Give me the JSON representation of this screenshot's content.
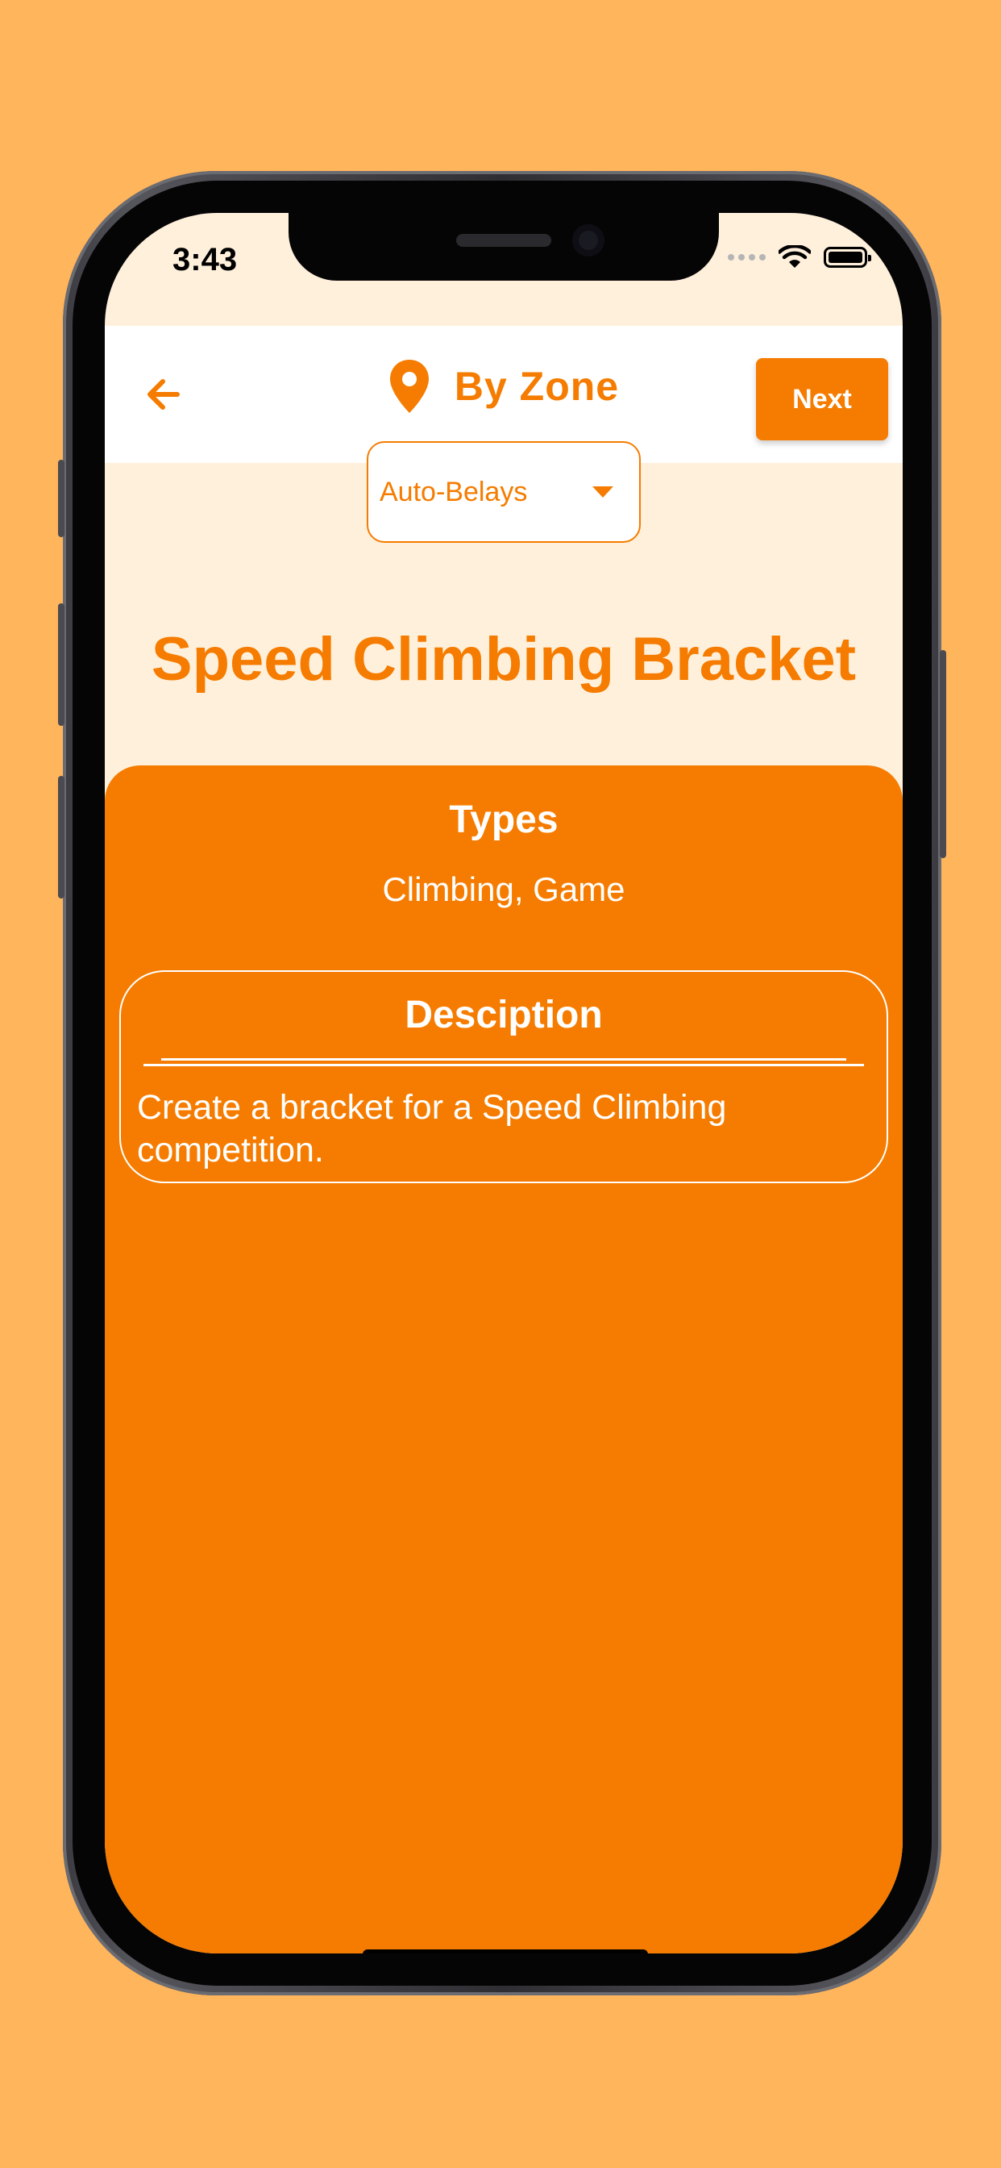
{
  "status_bar": {
    "time": "3:43"
  },
  "header": {
    "title": "By Zone",
    "next_label": "Next"
  },
  "zone_select": {
    "selected": "Auto-Belays"
  },
  "activity": {
    "title": "Speed Climbing Bracket",
    "types_heading": "Types",
    "types_value": "Climbing, Game",
    "description_heading": "Desciption",
    "description_text": "Create a bracket for a Speed Climbing competition."
  },
  "colors": {
    "background": "#FFB55C",
    "accent": "#F57C00",
    "screen_background": "#FFF0DC",
    "header_background": "#FFFFFF"
  },
  "icons": {
    "back": "arrow-left-icon",
    "location": "location-pin-icon",
    "dropdown": "caret-down-icon",
    "wifi": "wifi-icon",
    "battery": "battery-icon",
    "signal": "cellular-signal-icon"
  }
}
